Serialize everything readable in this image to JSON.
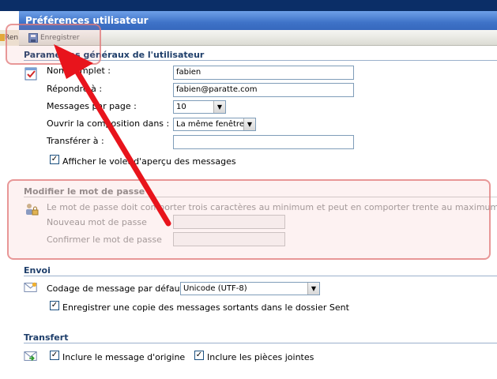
{
  "window": {
    "title": "Préférences utilisateur"
  },
  "left_fragment": {
    "label": "Ren"
  },
  "toolbar": {
    "save_label": "Enregistrer"
  },
  "general": {
    "header": "Paramètres généraux de l'utilisateur",
    "full_name": {
      "label": "Nom complet :",
      "value": "fabien"
    },
    "reply_to": {
      "label": "Répondre à :",
      "value": "fabien@paratte.com"
    },
    "per_page": {
      "label": "Messages par page :",
      "value": "10"
    },
    "compose_in": {
      "label": "Ouvrir la composition dans :",
      "value": "La même fenêtre"
    },
    "forward_to": {
      "label": "Transférer à :",
      "value": ""
    },
    "preview": {
      "label": "Afficher le volet d'aperçu des messages",
      "checked": true
    }
  },
  "password": {
    "header": "Modifier le mot de passe",
    "info": "Le mot de passe doit comporter trois caractères au minimum et peut en comporter trente au maximum.",
    "new_label": "Nouveau mot de passe",
    "confirm_label": "Confirmer le mot de passe"
  },
  "send": {
    "header": "Envoi",
    "encoding_label": "Codage de message par défaut",
    "encoding_value": "Unicode (UTF-8)",
    "save_copy": {
      "label": "Enregistrer une copie des messages sortants dans le dossier Sent",
      "checked": true
    }
  },
  "transfer": {
    "header": "Transfert",
    "include_original": {
      "label": "Inclure le message d'origine",
      "checked": true
    },
    "include_attachments": {
      "label": "Inclure les pièces jointes",
      "checked": true
    }
  },
  "colors": {
    "title_bar": "#3f73c8",
    "section_header": "#1f3f6b",
    "highlight": "#e07878",
    "arrow": "#e8141c"
  }
}
